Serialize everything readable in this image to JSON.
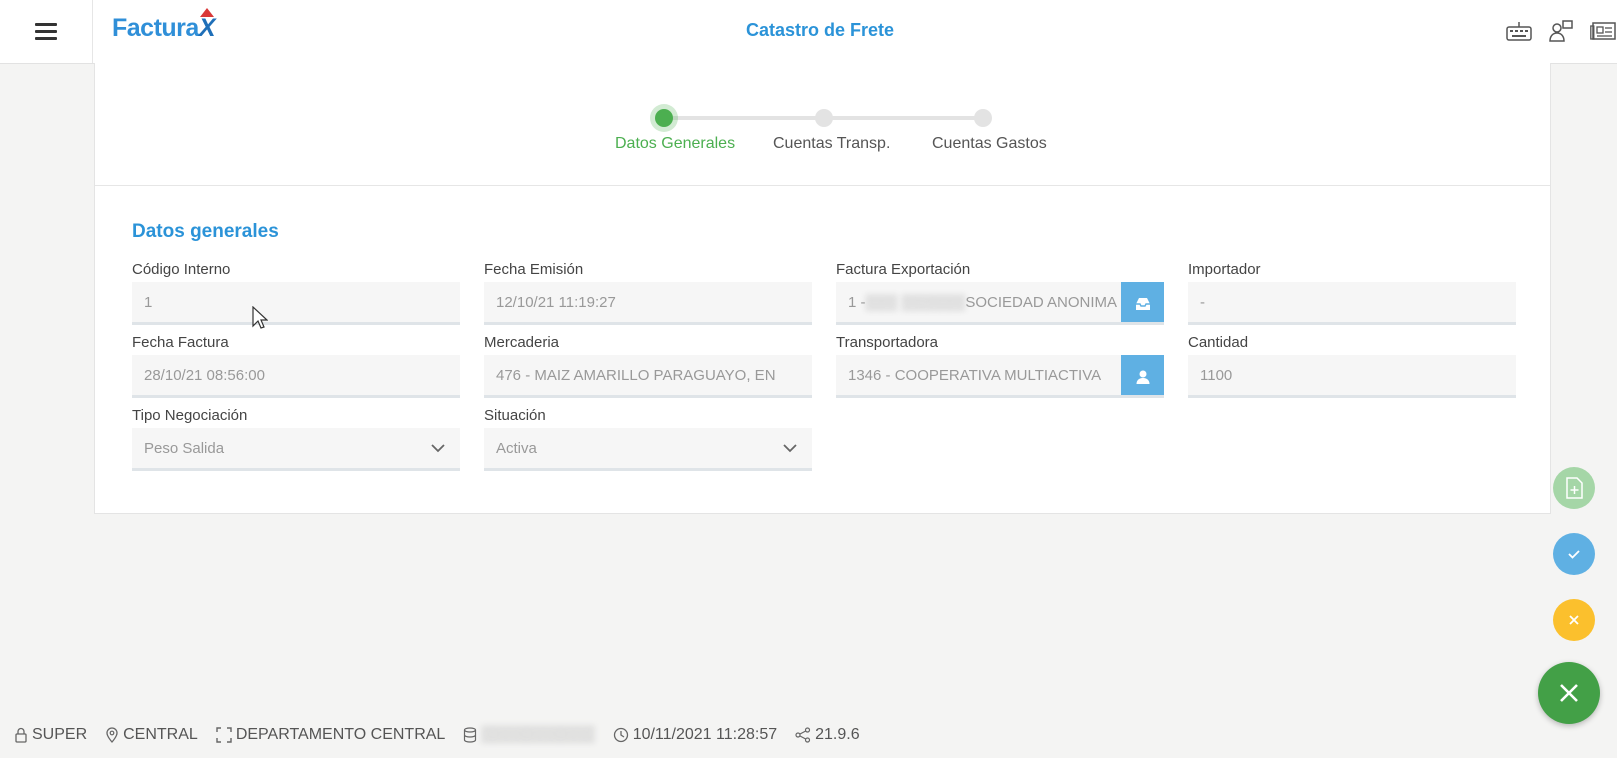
{
  "app": {
    "logo_text": "Factura",
    "logo_x": "X",
    "title": "Catastro de Frete"
  },
  "icons": {
    "menu": "hamburger-icon",
    "keyboard": "keyboard-icon",
    "users": "users-icon",
    "card": "id-card-icon"
  },
  "stepper": {
    "steps": [
      {
        "label": "Datos Generales",
        "active": true
      },
      {
        "label": "Cuentas Transp.",
        "active": false
      },
      {
        "label": "Cuentas Gastos",
        "active": false
      }
    ]
  },
  "form": {
    "section_title": "Datos generales",
    "codigo_interno": {
      "label": "Código Interno",
      "value": "1"
    },
    "fecha_emision": {
      "label": "Fecha Emisión",
      "value": "12/10/21 11:19:27"
    },
    "factura_exportacion": {
      "label": "Factura Exportación",
      "value_prefix": "1 - ",
      "value_hidden": "▒▒▒ ▒▒▒▒▒▒",
      "value_suffix": " SOCIEDAD ANONIMA"
    },
    "importador": {
      "label": "Importador",
      "value": "-"
    },
    "fecha_factura": {
      "label": "Fecha Factura",
      "value": "28/10/21 08:56:00"
    },
    "mercaderia": {
      "label": "Mercaderia",
      "value": "476 -  MAIZ AMARILLO PARAGUAYO, EN"
    },
    "transportadora": {
      "label": "Transportadora",
      "value": "1346 - COOPERATIVA MULTIACTIVA"
    },
    "cantidad": {
      "label": "Cantidad",
      "value": "1100"
    },
    "tipo_negociacion": {
      "label": "Tipo Negociación",
      "value": "Peso Salida"
    },
    "situacion": {
      "label": "Situación",
      "value": "Activa"
    }
  },
  "actions": {
    "colors": {
      "add": "#a5d6a7",
      "confirm": "#5fb0e3",
      "cancel": "#fbc02d",
      "close": "#43a047"
    }
  },
  "status_bar": {
    "user": "SUPER",
    "location": "CENTRAL",
    "department": "DEPARTAMENTO CENTRAL",
    "database": "▒▒▒▒▒▒▒▒▒▒",
    "datetime": "10/11/2021 11:28:57",
    "version": "21.9.6"
  }
}
